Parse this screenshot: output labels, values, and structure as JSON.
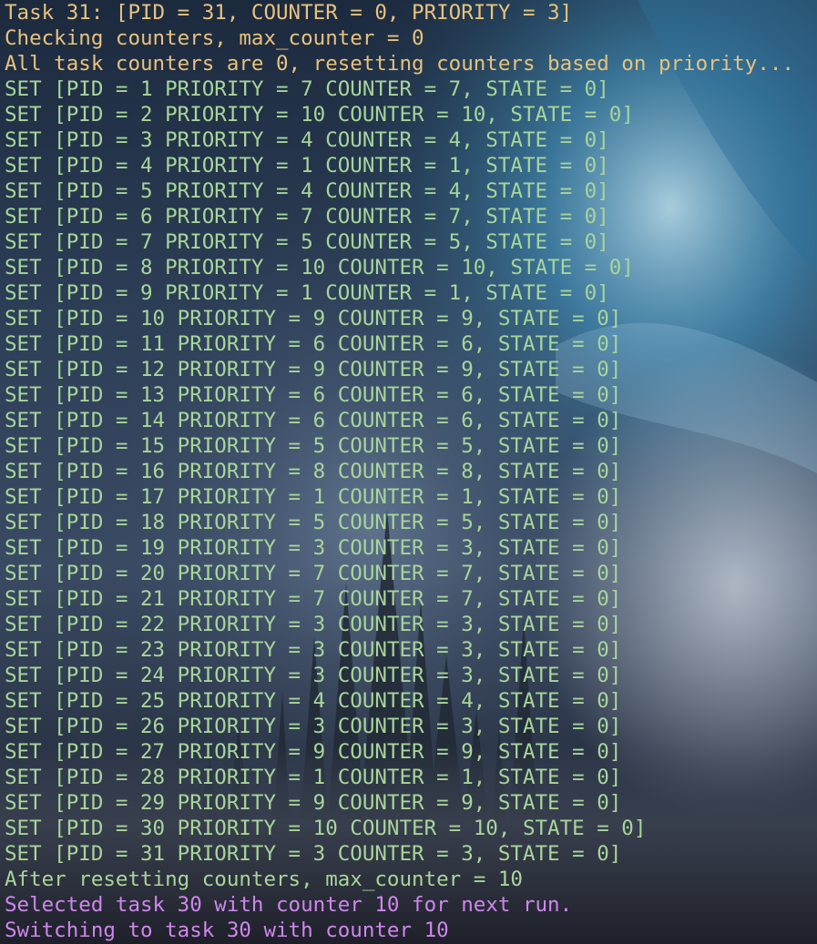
{
  "colors": {
    "header_text": "#e7c27d",
    "set_text": "#a8d59a",
    "after_text": "#a8d59a",
    "switch_text": "#cf86ee"
  },
  "terminal": {
    "header_lines": [
      "Task 31: [PID = 31, COUNTER = 0, PRIORITY = 3]",
      "Checking counters, max_counter = 0",
      "All task counters are 0, resetting counters based on priority..."
    ],
    "set_lines": [
      "SET [PID = 1 PRIORITY = 7 COUNTER = 7, STATE = 0]",
      "SET [PID = 2 PRIORITY = 10 COUNTER = 10, STATE = 0]",
      "SET [PID = 3 PRIORITY = 4 COUNTER = 4, STATE = 0]",
      "SET [PID = 4 PRIORITY = 1 COUNTER = 1, STATE = 0]",
      "SET [PID = 5 PRIORITY = 4 COUNTER = 4, STATE = 0]",
      "SET [PID = 6 PRIORITY = 7 COUNTER = 7, STATE = 0]",
      "SET [PID = 7 PRIORITY = 5 COUNTER = 5, STATE = 0]",
      "SET [PID = 8 PRIORITY = 10 COUNTER = 10, STATE = 0]",
      "SET [PID = 9 PRIORITY = 1 COUNTER = 1, STATE = 0]",
      "SET [PID = 10 PRIORITY = 9 COUNTER = 9, STATE = 0]",
      "SET [PID = 11 PRIORITY = 6 COUNTER = 6, STATE = 0]",
      "SET [PID = 12 PRIORITY = 9 COUNTER = 9, STATE = 0]",
      "SET [PID = 13 PRIORITY = 6 COUNTER = 6, STATE = 0]",
      "SET [PID = 14 PRIORITY = 6 COUNTER = 6, STATE = 0]",
      "SET [PID = 15 PRIORITY = 5 COUNTER = 5, STATE = 0]",
      "SET [PID = 16 PRIORITY = 8 COUNTER = 8, STATE = 0]",
      "SET [PID = 17 PRIORITY = 1 COUNTER = 1, STATE = 0]",
      "SET [PID = 18 PRIORITY = 5 COUNTER = 5, STATE = 0]",
      "SET [PID = 19 PRIORITY = 3 COUNTER = 3, STATE = 0]",
      "SET [PID = 20 PRIORITY = 7 COUNTER = 7, STATE = 0]",
      "SET [PID = 21 PRIORITY = 7 COUNTER = 7, STATE = 0]",
      "SET [PID = 22 PRIORITY = 3 COUNTER = 3, STATE = 0]",
      "SET [PID = 23 PRIORITY = 3 COUNTER = 3, STATE = 0]",
      "SET [PID = 24 PRIORITY = 3 COUNTER = 3, STATE = 0]",
      "SET [PID = 25 PRIORITY = 4 COUNTER = 4, STATE = 0]",
      "SET [PID = 26 PRIORITY = 3 COUNTER = 3, STATE = 0]",
      "SET [PID = 27 PRIORITY = 9 COUNTER = 9, STATE = 0]",
      "SET [PID = 28 PRIORITY = 1 COUNTER = 1, STATE = 0]",
      "SET [PID = 29 PRIORITY = 9 COUNTER = 9, STATE = 0]",
      "SET [PID = 30 PRIORITY = 10 COUNTER = 10, STATE = 0]",
      "SET [PID = 31 PRIORITY = 3 COUNTER = 3, STATE = 0]"
    ],
    "after_line": "After resetting counters, max_counter = 10",
    "selected_line": "Selected task 30 with counter 10 for next run.",
    "switching_line": "Switching to task 30 with counter 10"
  }
}
